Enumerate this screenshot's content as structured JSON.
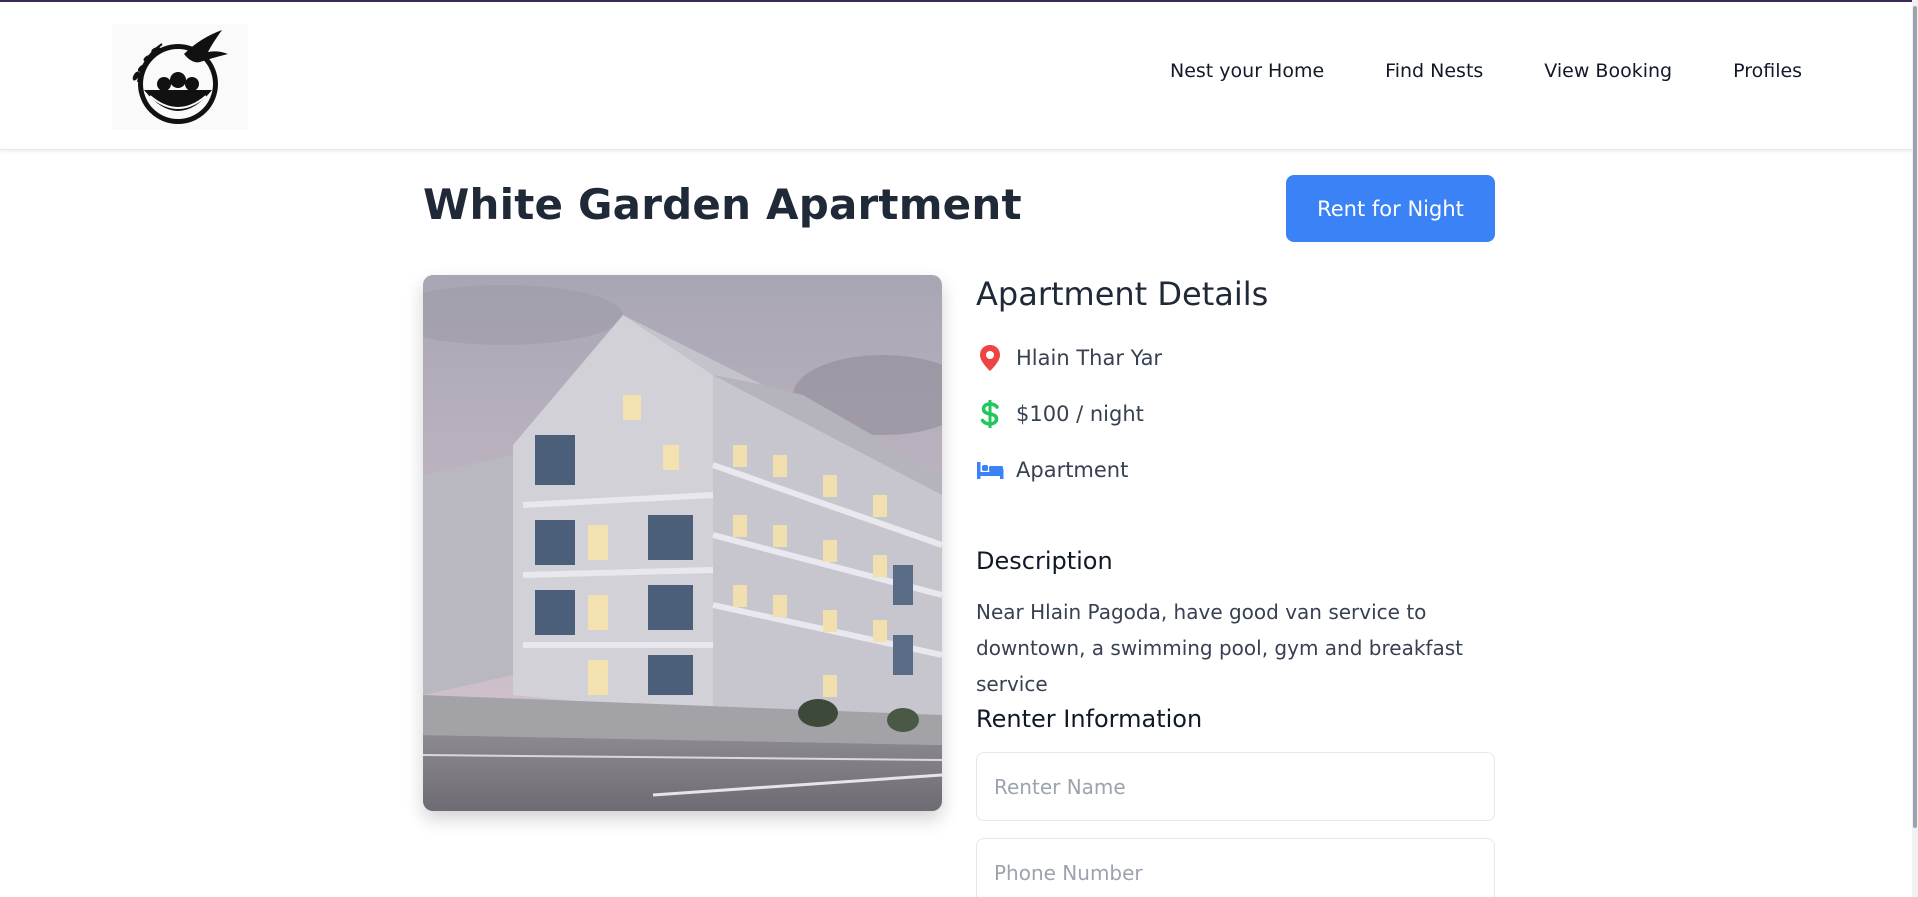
{
  "nav": {
    "logo_alt": "Nest logo",
    "items": [
      {
        "label": "Nest your Home"
      },
      {
        "label": "Find Nests"
      },
      {
        "label": "View Booking"
      },
      {
        "label": "Profiles"
      }
    ]
  },
  "listing": {
    "title": "White Garden Apartment",
    "rent_button": "Rent for Night",
    "details_heading": "Apartment Details",
    "location": "Hlain Thar Yar",
    "price": "$100 / night",
    "type": "Apartment",
    "description_heading": "Description",
    "description": "Near Hlain Pagoda, have good van service to downtown, a swimming pool, gym and breakfast service"
  },
  "renter": {
    "heading": "Renter Information",
    "name_placeholder": "Renter Name",
    "phone_placeholder": "Phone Number"
  },
  "icons": {
    "location": "map-pin-icon",
    "price": "dollar-sign-icon",
    "type": "bed-icon"
  },
  "colors": {
    "accent": "#3b82f6",
    "pin": "#ef4444",
    "dollar": "#22c55e",
    "bed": "#3b82f6"
  }
}
